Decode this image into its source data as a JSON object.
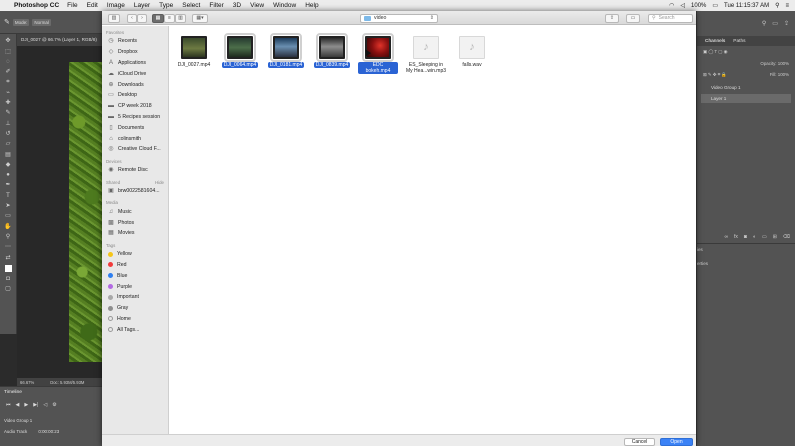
{
  "menubar": {
    "app_name": "Photoshop CC",
    "items": [
      "File",
      "Edit",
      "Image",
      "Layer",
      "Type",
      "Select",
      "Filter",
      "3D",
      "View",
      "Window",
      "Help"
    ],
    "battery": "100%",
    "clock": "Tue 11:15:37 AM"
  },
  "ps": {
    "options": {
      "mode_label": "Mode:",
      "mode_value": "Normal"
    },
    "doc_tab": "DJI_0027 @ 66.7% (Layer 1, RGB/8)",
    "status": {
      "zoom": "66.67%",
      "doc": "Doc: 5.93M/5.93M"
    },
    "timeline": {
      "title": "Timeline",
      "track": "Video Group 1",
      "audio": "Audio Track",
      "timecode": "0:00:00:23"
    },
    "right": {
      "tabs": [
        "Channels",
        "Paths"
      ],
      "opacity_label": "Opacity:",
      "opacity_value": "100%",
      "fill_label": "Fill:",
      "fill_value": "100%",
      "group": "Video Group 1",
      "layer": "Layer 1",
      "lower_label_1": "ies",
      "lower_label_2": "erties"
    }
  },
  "dialog": {
    "location": "video",
    "search_placeholder": "Search",
    "sidebar": {
      "favorites_header": "Favorites",
      "favorites": [
        "Recents",
        "Dropbox",
        "Applications",
        "iCloud Drive",
        "Downloads",
        "Desktop",
        "CP week 2018",
        "5 Recipes session",
        "Documents",
        "colinsmith",
        "Creative Cloud F..."
      ],
      "devices_header": "Devices",
      "devices": [
        "Remote Disc"
      ],
      "shared_header": "Shared",
      "shared_hide": "Hide",
      "shared": [
        "brw0022581604..."
      ],
      "media_header": "Media",
      "media": [
        "Music",
        "Photos",
        "Movies"
      ],
      "tags_header": "Tags",
      "tags": [
        {
          "label": "Yellow",
          "color": "#f5c518"
        },
        {
          "label": "Red",
          "color": "#f23b3b"
        },
        {
          "label": "Blue",
          "color": "#2f7ff0"
        },
        {
          "label": "Purple",
          "color": "#b36ae2"
        },
        {
          "label": "Important",
          "color": "#a8a8a8"
        },
        {
          "label": "Gray",
          "color": "#8e8e8e"
        },
        {
          "label": "Home",
          "color": "#ffffff"
        },
        {
          "label": "All Tags...",
          "color": "#ffffff"
        }
      ]
    },
    "files": [
      {
        "name": "DJI_0027.mp4",
        "selected": false,
        "kind": "video"
      },
      {
        "name": "DJI_0064.mp4",
        "selected": true,
        "kind": "video"
      },
      {
        "name": "DJI_0181.mp4",
        "selected": true,
        "kind": "video"
      },
      {
        "name": "DJI_0839.mp4",
        "selected": true,
        "kind": "video"
      },
      {
        "name": "EDC bokeh.mp4",
        "selected": true,
        "kind": "video"
      },
      {
        "name": "ES_Sleeping in My Hea...win.mp3",
        "selected": false,
        "kind": "audio"
      },
      {
        "name": "falls.wav",
        "selected": false,
        "kind": "audio"
      }
    ],
    "buttons": {
      "cancel": "Cancel",
      "open": "Open"
    }
  }
}
